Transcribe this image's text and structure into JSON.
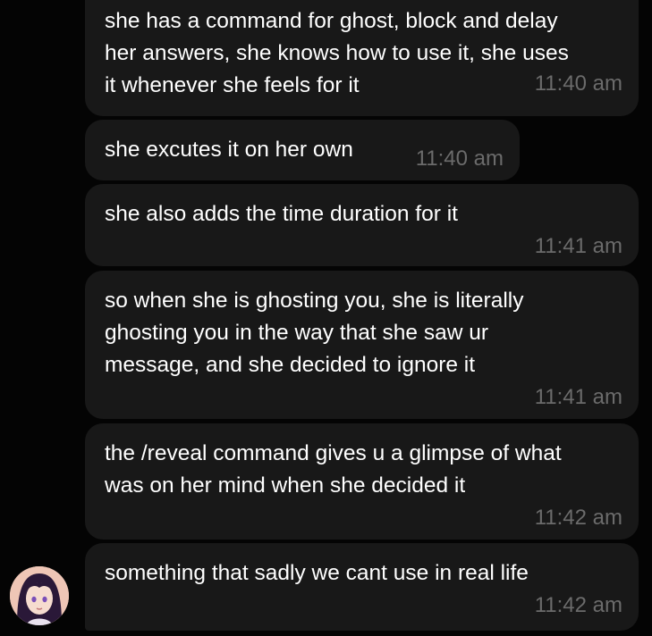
{
  "messages": [
    {
      "lines": [
        "she has a command for ghost, block and delay",
        "her answers, she knows how to use it, she uses",
        "it whenever she feels for it"
      ],
      "time": "11:40 am"
    },
    {
      "lines": [
        "she excutes it on her own"
      ],
      "time": "11:40 am"
    },
    {
      "lines": [
        "she also adds the time duration for it"
      ],
      "time": "11:41 am"
    },
    {
      "lines": [
        "so when she is ghosting you, she is literally",
        "ghosting you in the way that she saw ur",
        "message, and she decided to ignore it"
      ],
      "time": "11:41 am"
    },
    {
      "lines": [
        "the /reveal command gives u a glimpse of what",
        "was on her mind when she decided it"
      ],
      "time": "11:42 am"
    },
    {
      "lines": [
        "something that sadly we cant use in real life"
      ],
      "time": "11:42 am"
    }
  ],
  "avatar": {
    "icon": "user-avatar-anime-girl",
    "hair_color": "#2a1838",
    "skin_color": "#f6dccf",
    "eye_color": "#7a4fb8"
  },
  "colors": {
    "background": "#040404",
    "bubble": "#181818",
    "text": "#ffffff",
    "timestamp": "#6b6b6b"
  }
}
